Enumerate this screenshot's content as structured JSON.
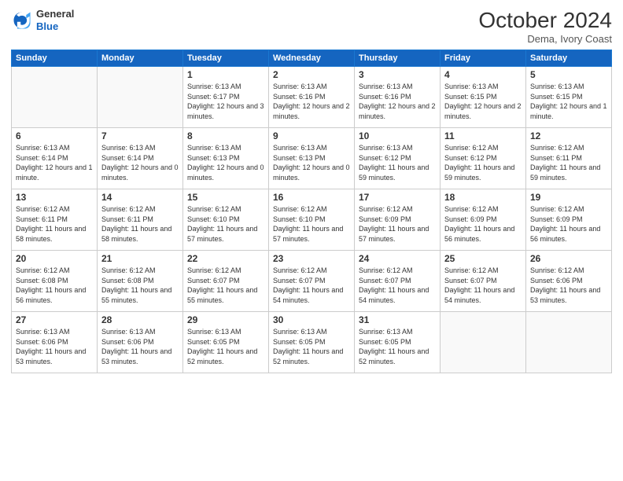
{
  "header": {
    "logo_general": "General",
    "logo_blue": "Blue",
    "month_title": "October 2024",
    "location": "Dema, Ivory Coast"
  },
  "weekdays": [
    "Sunday",
    "Monday",
    "Tuesday",
    "Wednesday",
    "Thursday",
    "Friday",
    "Saturday"
  ],
  "weeks": [
    [
      {
        "day": "",
        "text": ""
      },
      {
        "day": "",
        "text": ""
      },
      {
        "day": "1",
        "text": "Sunrise: 6:13 AM\nSunset: 6:17 PM\nDaylight: 12 hours and 3 minutes."
      },
      {
        "day": "2",
        "text": "Sunrise: 6:13 AM\nSunset: 6:16 PM\nDaylight: 12 hours and 2 minutes."
      },
      {
        "day": "3",
        "text": "Sunrise: 6:13 AM\nSunset: 6:16 PM\nDaylight: 12 hours and 2 minutes."
      },
      {
        "day": "4",
        "text": "Sunrise: 6:13 AM\nSunset: 6:15 PM\nDaylight: 12 hours and 2 minutes."
      },
      {
        "day": "5",
        "text": "Sunrise: 6:13 AM\nSunset: 6:15 PM\nDaylight: 12 hours and 1 minute."
      }
    ],
    [
      {
        "day": "6",
        "text": "Sunrise: 6:13 AM\nSunset: 6:14 PM\nDaylight: 12 hours and 1 minute."
      },
      {
        "day": "7",
        "text": "Sunrise: 6:13 AM\nSunset: 6:14 PM\nDaylight: 12 hours and 0 minutes."
      },
      {
        "day": "8",
        "text": "Sunrise: 6:13 AM\nSunset: 6:13 PM\nDaylight: 12 hours and 0 minutes."
      },
      {
        "day": "9",
        "text": "Sunrise: 6:13 AM\nSunset: 6:13 PM\nDaylight: 12 hours and 0 minutes."
      },
      {
        "day": "10",
        "text": "Sunrise: 6:13 AM\nSunset: 6:12 PM\nDaylight: 11 hours and 59 minutes."
      },
      {
        "day": "11",
        "text": "Sunrise: 6:12 AM\nSunset: 6:12 PM\nDaylight: 11 hours and 59 minutes."
      },
      {
        "day": "12",
        "text": "Sunrise: 6:12 AM\nSunset: 6:11 PM\nDaylight: 11 hours and 59 minutes."
      }
    ],
    [
      {
        "day": "13",
        "text": "Sunrise: 6:12 AM\nSunset: 6:11 PM\nDaylight: 11 hours and 58 minutes."
      },
      {
        "day": "14",
        "text": "Sunrise: 6:12 AM\nSunset: 6:11 PM\nDaylight: 11 hours and 58 minutes."
      },
      {
        "day": "15",
        "text": "Sunrise: 6:12 AM\nSunset: 6:10 PM\nDaylight: 11 hours and 57 minutes."
      },
      {
        "day": "16",
        "text": "Sunrise: 6:12 AM\nSunset: 6:10 PM\nDaylight: 11 hours and 57 minutes."
      },
      {
        "day": "17",
        "text": "Sunrise: 6:12 AM\nSunset: 6:09 PM\nDaylight: 11 hours and 57 minutes."
      },
      {
        "day": "18",
        "text": "Sunrise: 6:12 AM\nSunset: 6:09 PM\nDaylight: 11 hours and 56 minutes."
      },
      {
        "day": "19",
        "text": "Sunrise: 6:12 AM\nSunset: 6:09 PM\nDaylight: 11 hours and 56 minutes."
      }
    ],
    [
      {
        "day": "20",
        "text": "Sunrise: 6:12 AM\nSunset: 6:08 PM\nDaylight: 11 hours and 56 minutes."
      },
      {
        "day": "21",
        "text": "Sunrise: 6:12 AM\nSunset: 6:08 PM\nDaylight: 11 hours and 55 minutes."
      },
      {
        "day": "22",
        "text": "Sunrise: 6:12 AM\nSunset: 6:07 PM\nDaylight: 11 hours and 55 minutes."
      },
      {
        "day": "23",
        "text": "Sunrise: 6:12 AM\nSunset: 6:07 PM\nDaylight: 11 hours and 54 minutes."
      },
      {
        "day": "24",
        "text": "Sunrise: 6:12 AM\nSunset: 6:07 PM\nDaylight: 11 hours and 54 minutes."
      },
      {
        "day": "25",
        "text": "Sunrise: 6:12 AM\nSunset: 6:07 PM\nDaylight: 11 hours and 54 minutes."
      },
      {
        "day": "26",
        "text": "Sunrise: 6:12 AM\nSunset: 6:06 PM\nDaylight: 11 hours and 53 minutes."
      }
    ],
    [
      {
        "day": "27",
        "text": "Sunrise: 6:13 AM\nSunset: 6:06 PM\nDaylight: 11 hours and 53 minutes."
      },
      {
        "day": "28",
        "text": "Sunrise: 6:13 AM\nSunset: 6:06 PM\nDaylight: 11 hours and 53 minutes."
      },
      {
        "day": "29",
        "text": "Sunrise: 6:13 AM\nSunset: 6:05 PM\nDaylight: 11 hours and 52 minutes."
      },
      {
        "day": "30",
        "text": "Sunrise: 6:13 AM\nSunset: 6:05 PM\nDaylight: 11 hours and 52 minutes."
      },
      {
        "day": "31",
        "text": "Sunrise: 6:13 AM\nSunset: 6:05 PM\nDaylight: 11 hours and 52 minutes."
      },
      {
        "day": "",
        "text": ""
      },
      {
        "day": "",
        "text": ""
      }
    ]
  ]
}
